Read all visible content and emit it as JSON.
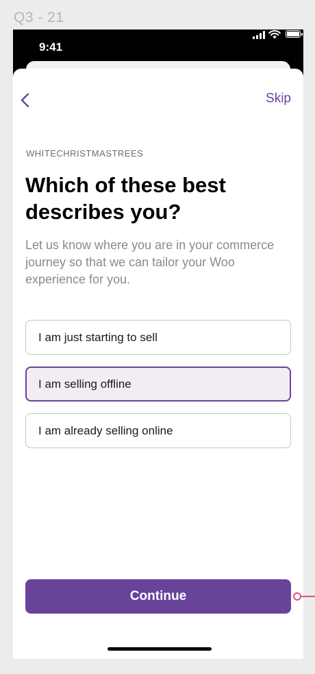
{
  "frame": {
    "label": "Q3 - 21"
  },
  "statusbar": {
    "time": "9:41",
    "icons": [
      "signal-icon",
      "wifi-icon",
      "battery-icon"
    ]
  },
  "nav": {
    "back_icon": "chevron-left-icon",
    "skip_label": "Skip"
  },
  "store_name": "WHITECHRISTMASTREES",
  "title": "Which of these best describes you?",
  "subtitle": "Let us know where you are in your commerce journey so that we can tailor your Woo experience for you.",
  "options": [
    {
      "label": "I am just starting to sell",
      "selected": false
    },
    {
      "label": "I am selling offline",
      "selected": true
    },
    {
      "label": "I am already selling online",
      "selected": false
    }
  ],
  "continue_label": "Continue",
  "colors": {
    "accent": "#674399",
    "selected_bg": "#f2edf5",
    "connector": "#d6548a",
    "background": "#ececec"
  }
}
